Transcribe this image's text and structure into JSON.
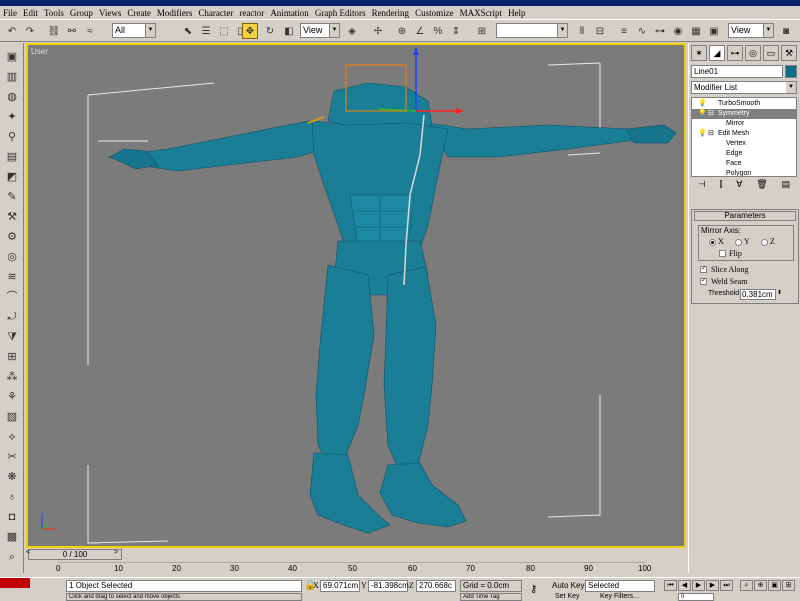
{
  "menu": [
    "File",
    "Edit",
    "Tools",
    "Group",
    "Views",
    "Create",
    "Modifiers",
    "Character",
    "reactor",
    "Animation",
    "Graph Editors",
    "Rendering",
    "Customize",
    "MAXScript",
    "Help"
  ],
  "toolbar": {
    "selection_filter": "All",
    "coord_system": "View",
    "named_selection": "",
    "view_select": "View"
  },
  "viewport": {
    "label": "User"
  },
  "command_panel": {
    "object_name": "Line01",
    "object_color": "#0e6b8a",
    "modifier_list": "Modifier List",
    "stack": [
      {
        "label": "TurboSmooth"
      },
      {
        "label": "Symmetry"
      },
      {
        "label": "Mirror"
      },
      {
        "label": "Edit Mesh"
      },
      {
        "label": "Vertex"
      },
      {
        "label": "Edge"
      },
      {
        "label": "Face"
      },
      {
        "label": "Polygon"
      }
    ],
    "rollout_title": "Parameters",
    "mirror_axis_label": "Mirror Axis:",
    "axis_x": "X",
    "axis_y": "Y",
    "axis_z": "Z",
    "selected_axis": "X",
    "flip_label": "Flip",
    "flip_checked": false,
    "slice_along_label": "Slice Along",
    "slice_along_checked": true,
    "weld_seam_label": "Weld Seam",
    "weld_seam_checked": true,
    "threshold_label": "Threshold",
    "threshold_value": "0.381cm"
  },
  "timeline": {
    "frame_counter": "0 / 100",
    "ticks": [
      "0",
      "10",
      "20",
      "30",
      "40",
      "50",
      "60",
      "70",
      "80",
      "90",
      "100"
    ]
  },
  "status": {
    "selection_text": "1 Object Selected",
    "x_label": "X",
    "x_value": "69.071cm",
    "y_label": "Y",
    "y_value": "-81.398cm",
    "z_label": "Z",
    "z_value": "270.668c",
    "grid_text": "Grid = 0.0cm",
    "auto_key": "Auto Key",
    "set_key_mode": "Selected",
    "set_key": "Set Key",
    "key_filters": "Key Filters...",
    "add_time_tag": "Add Time Tag",
    "prompt_text": "Click and drag to select and move objects",
    "current_frame": "0"
  }
}
